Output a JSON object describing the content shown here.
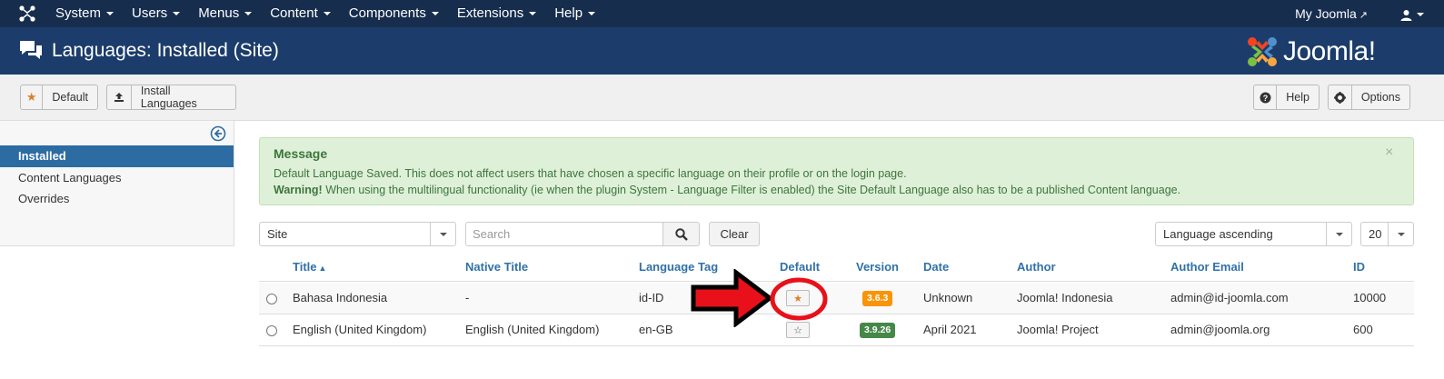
{
  "topnav": {
    "items": [
      "System",
      "Users",
      "Menus",
      "Content",
      "Components",
      "Extensions",
      "Help"
    ],
    "my_joomla": "My Joomla"
  },
  "header": {
    "title": "Languages: Installed (Site)",
    "brand": "Joomla!"
  },
  "toolbar": {
    "default_label": "Default",
    "install_label": "Install Languages",
    "help_label": "Help",
    "options_label": "Options"
  },
  "sidebar": {
    "items": [
      {
        "label": "Installed",
        "active": true
      },
      {
        "label": "Content Languages",
        "active": false
      },
      {
        "label": "Overrides",
        "active": false
      }
    ]
  },
  "message": {
    "heading": "Message",
    "line1": "Default Language Saved. This does not affect users that have chosen a specific language on their profile or on the login page.",
    "warning_label": "Warning!",
    "line2": "When using the multilingual functionality (ie when the plugin System - Language Filter is enabled) the Site Default Language also has to be a published Content language.",
    "close": "×"
  },
  "filters": {
    "client": "Site",
    "search_placeholder": "Search",
    "clear_label": "Clear",
    "ordering": "Language ascending",
    "limit": "20"
  },
  "table": {
    "columns": {
      "title": "Title",
      "native_title": "Native Title",
      "tag": "Language Tag",
      "default": "Default",
      "version": "Version",
      "date": "Date",
      "author": "Author",
      "email": "Author Email",
      "id": "ID"
    },
    "rows": [
      {
        "title": "Bahasa Indonesia",
        "native_title": "-",
        "tag": "id-ID",
        "is_default": true,
        "version": "3.6.3",
        "version_color": "#f89406",
        "date": "Unknown",
        "author": "Joomla! Indonesia",
        "email": "admin@id-joomla.com",
        "id": "10000"
      },
      {
        "title": "English (United Kingdom)",
        "native_title": "English (United Kingdom)",
        "tag": "en-GB",
        "is_default": false,
        "version": "3.9.26",
        "version_color": "#468847",
        "date": "April 2021",
        "author": "Joomla! Project",
        "email": "admin@joomla.org",
        "id": "600"
      }
    ]
  },
  "colors": {
    "navbar": "#172d4e",
    "header": "#1c3d6b",
    "sidebar_active": "#2d6ca2",
    "link": "#3071a9",
    "star": "#d9822b",
    "annotation_arrow": "#e8101a",
    "annotation_ring": "#e8101a"
  }
}
